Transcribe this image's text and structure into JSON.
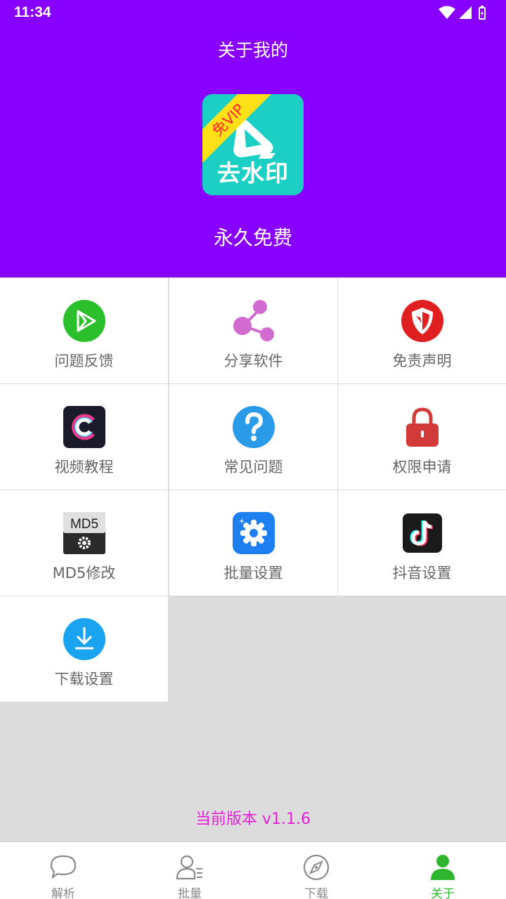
{
  "status_bar": {
    "time": "11:34"
  },
  "header": {
    "title": "关于我的",
    "logo_text": "去水印",
    "logo_badge": "免VIP",
    "subtitle": "永久免费"
  },
  "grid": [
    {
      "label": "问题反馈",
      "icon": "play-icon",
      "color": "#2bc02b"
    },
    {
      "label": "分享软件",
      "icon": "share-icon",
      "color": "#d26bd0"
    },
    {
      "label": "免责声明",
      "icon": "shield-icon",
      "color": "#e02020"
    },
    {
      "label": "视频教程",
      "icon": "video-tutorial-icon",
      "color": "#1a1a2a"
    },
    {
      "label": "常见问题",
      "icon": "question-icon",
      "color": "#2a9be8"
    },
    {
      "label": "权限申请",
      "icon": "lock-icon",
      "color": "#d23a3a"
    },
    {
      "label": "MD5修改",
      "icon": "md5-icon",
      "color": "#333333"
    },
    {
      "label": "批量设置",
      "icon": "gear-icon",
      "color": "#1e7ff0"
    },
    {
      "label": "抖音设置",
      "icon": "tiktok-icon",
      "color": "#1a1a1a"
    },
    {
      "label": "下载设置",
      "icon": "download-icon",
      "color": "#1aa3f0"
    }
  ],
  "md5_badge": "MD5",
  "version": "当前版本 v1.1.6",
  "tabbar": {
    "tabs": [
      {
        "label": "解析",
        "icon": "chat-bubble-icon",
        "active": false
      },
      {
        "label": "批量",
        "icon": "user-list-icon",
        "active": false
      },
      {
        "label": "下载",
        "icon": "compass-icon",
        "active": false
      },
      {
        "label": "关于",
        "icon": "person-icon",
        "active": true
      }
    ],
    "active_color": "#2fb52f",
    "inactive_color": "#8a8a8a"
  },
  "colors": {
    "header_bg": "#8800ff",
    "logo_bg": "#1ccfc4",
    "version_text": "#e61ed8"
  }
}
